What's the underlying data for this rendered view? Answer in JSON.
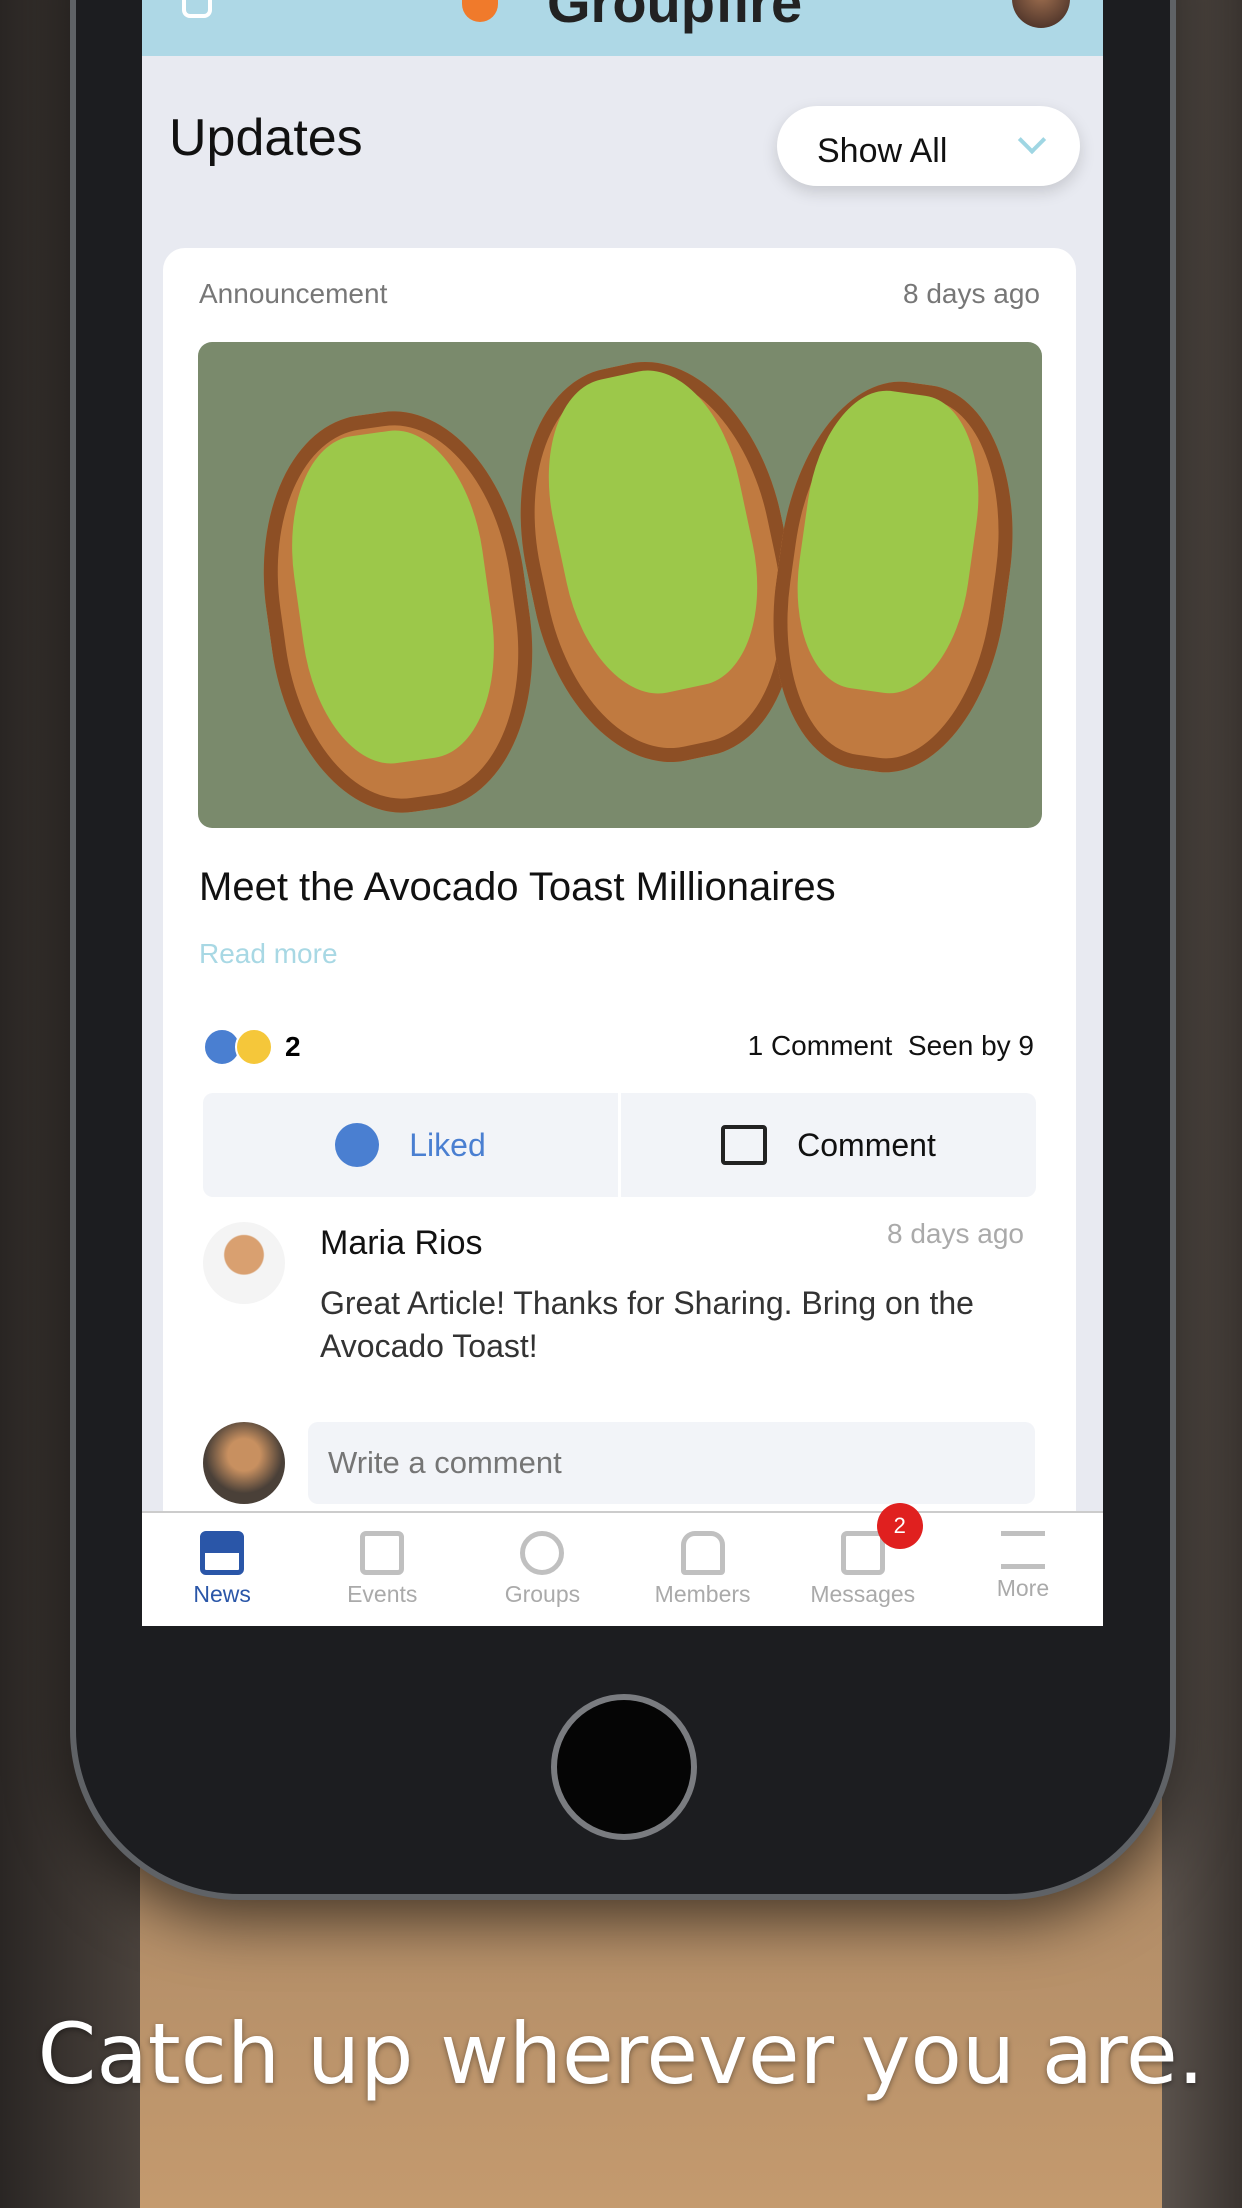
{
  "app": {
    "name": "Groupfire"
  },
  "page": {
    "title": "Updates",
    "filter": "Show All"
  },
  "post": {
    "type": "Announcement",
    "time": "8 days ago",
    "title": "Meet the Avocado Toast Millionaires",
    "read_more": "Read more",
    "reaction_count": "2",
    "comments": "1 Comment",
    "seen": "Seen by 9",
    "liked_label": "Liked",
    "comment_label": "Comment"
  },
  "comment": {
    "author": "Maria Rios",
    "time": "8 days ago",
    "text": "Great Article! Thanks for Sharing. Bring on the Avocado Toast!"
  },
  "composer": {
    "placeholder": "Write a comment"
  },
  "tabs": [
    {
      "label": "News",
      "icon": "newspaper-icon"
    },
    {
      "label": "Events",
      "icon": "calendar-icon"
    },
    {
      "label": "Groups",
      "icon": "groups-icon"
    },
    {
      "label": "Members",
      "icon": "members-icon"
    },
    {
      "label": "Messages",
      "icon": "chat-icon",
      "badge": "2"
    },
    {
      "label": "More",
      "icon": "menu-icon"
    }
  ],
  "active_tab": "News",
  "caption": "Catch up wherever you are.",
  "colors": {
    "header": "#aed8e6",
    "accent": "#2a56a8",
    "badge": "#e0201f",
    "like": "#4a7fd1"
  }
}
